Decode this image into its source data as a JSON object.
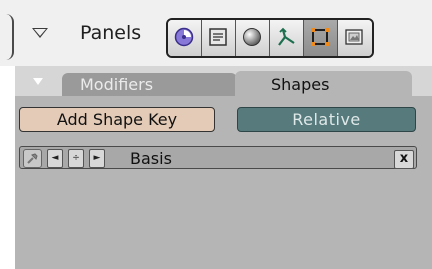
{
  "header": {
    "title": "Panels",
    "context_buttons": [
      {
        "icon": "scene-sphere-icon",
        "active": false
      },
      {
        "icon": "shading-icon",
        "active": false
      },
      {
        "icon": "material-ball-icon",
        "active": false
      },
      {
        "icon": "physics-icon",
        "active": false
      },
      {
        "icon": "editing-icon",
        "active": true
      },
      {
        "icon": "image-icon",
        "active": false
      }
    ]
  },
  "tabs": {
    "items": [
      "Modifiers",
      "Shapes"
    ],
    "active": "Shapes"
  },
  "shapes": {
    "add_shape_key_label": "Add Shape Key",
    "relative_label": "Relative",
    "key_name": "Basis",
    "delete_label": "x",
    "prev_symbol": "◄",
    "updown_symbol": "÷",
    "next_symbol": "►"
  },
  "colors": {
    "add_button": "#e3cbb7",
    "relative_button": "#577a7c",
    "panel_bg": "#b5b5b5",
    "tab_inactive": "#9a9a9a"
  }
}
